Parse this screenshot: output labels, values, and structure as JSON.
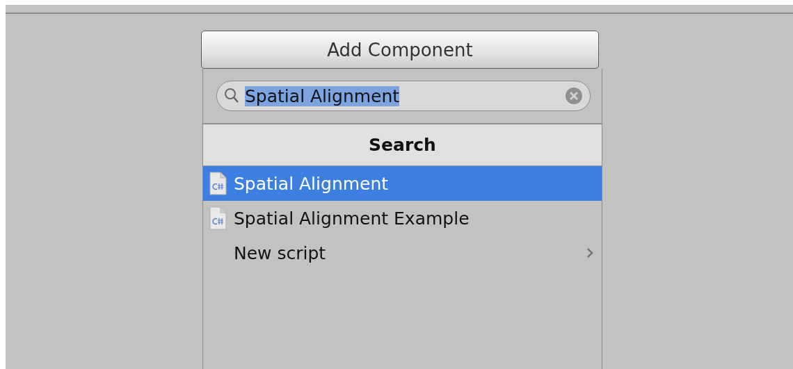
{
  "add_component_button": {
    "label": "Add Component"
  },
  "search_field": {
    "value": "Spatial Alignment",
    "text_selected": true
  },
  "results_header": {
    "title": "Search"
  },
  "items": [
    {
      "kind": "script",
      "label": "Spatial Alignment",
      "selected": true
    },
    {
      "kind": "script",
      "label": "Spatial Alignment Example",
      "selected": false
    },
    {
      "kind": "submenu",
      "label": "New script",
      "selected": false
    }
  ]
}
